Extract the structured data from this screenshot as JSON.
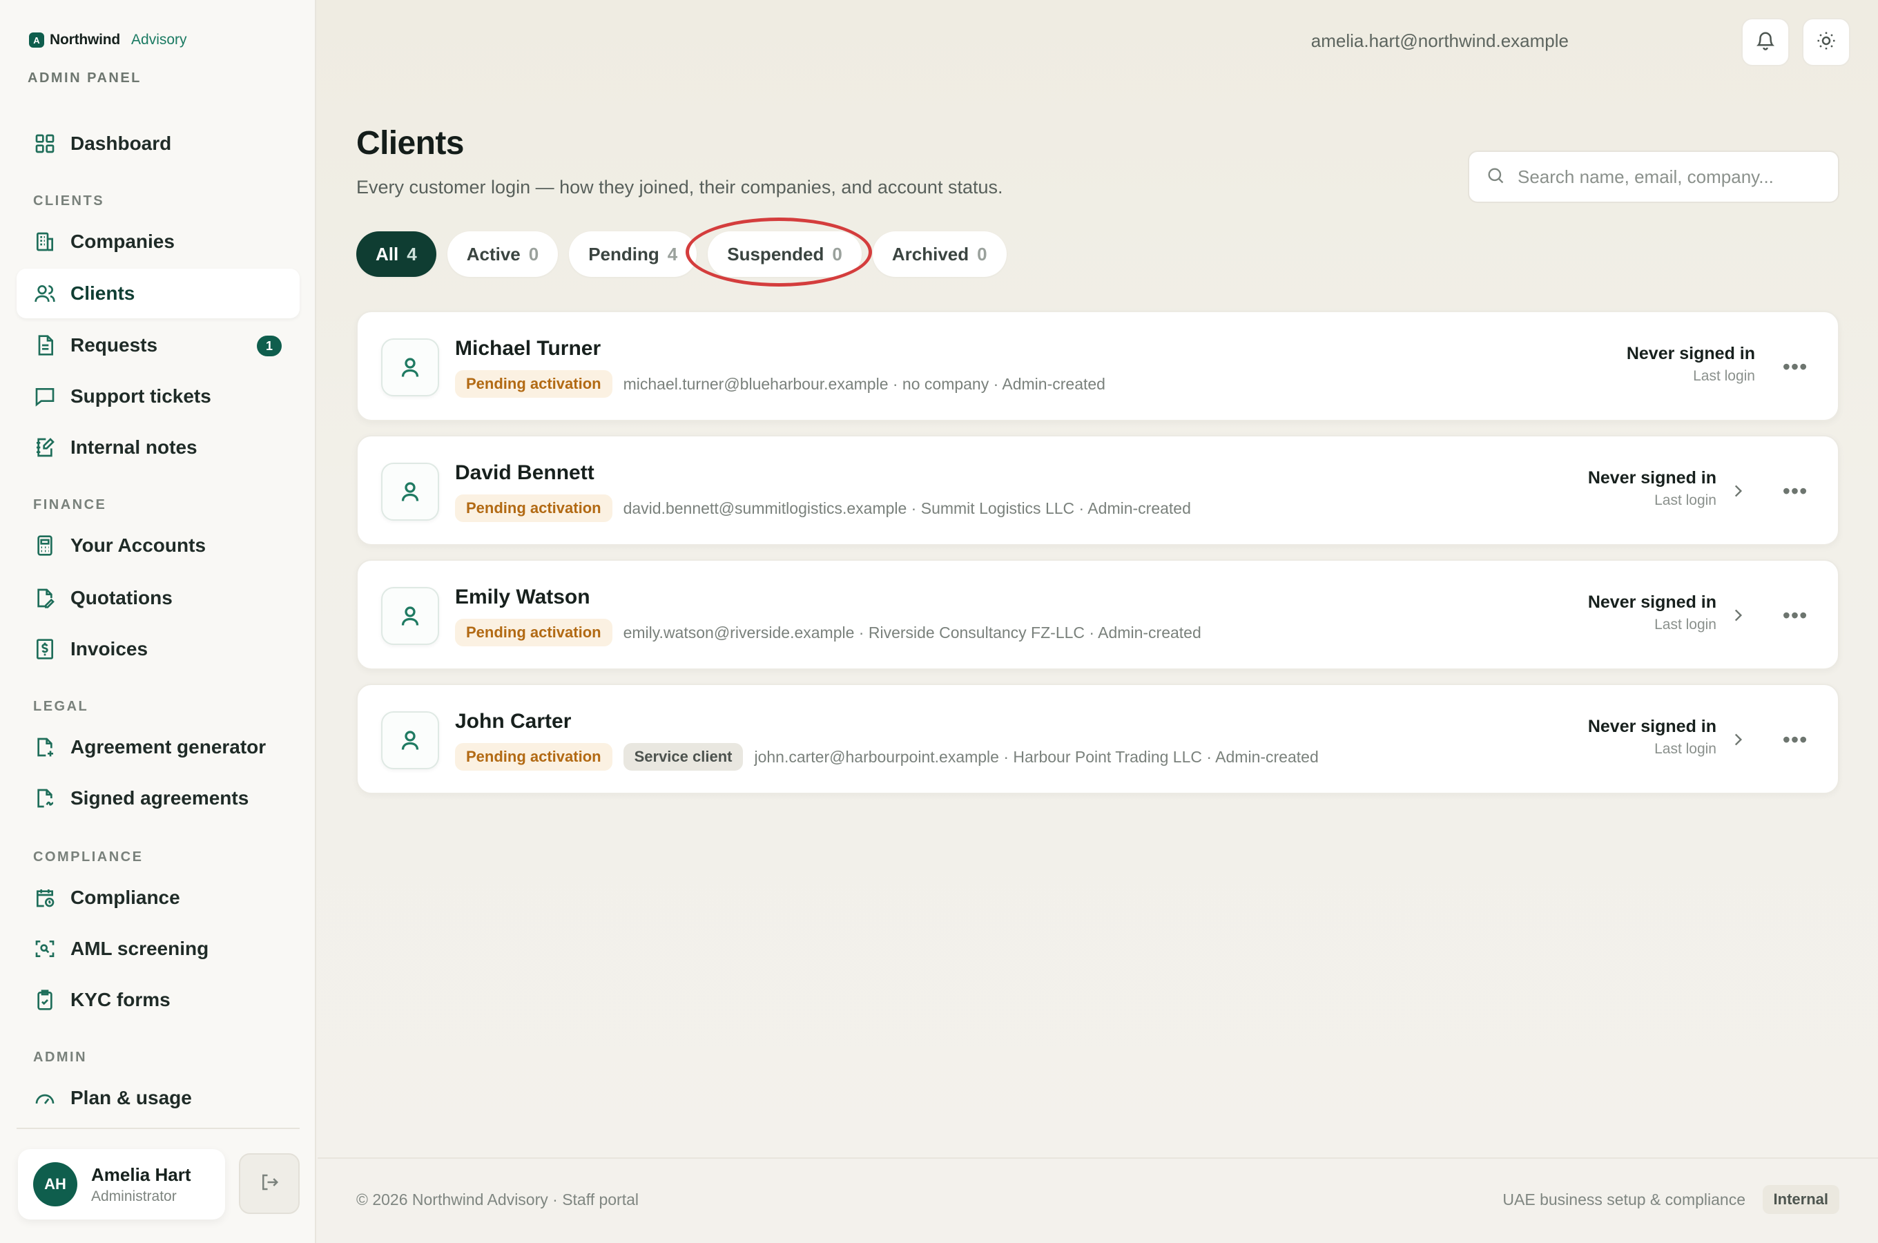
{
  "brand": {
    "logo_letter": "A",
    "name": "Northwind",
    "sub": "Advisory",
    "panel": "ADMIN PANEL"
  },
  "nav": {
    "dashboard": "Dashboard",
    "sections": {
      "clients": "CLIENTS",
      "finance": "FINANCE",
      "legal": "LEGAL",
      "compliance": "COMPLIANCE",
      "admin": "ADMIN"
    },
    "items": {
      "companies": "Companies",
      "clients": "Clients",
      "requests": "Requests",
      "requests_badge": "1",
      "support_tickets": "Support tickets",
      "internal_notes": "Internal notes",
      "your_accounts": "Your Accounts",
      "quotations": "Quotations",
      "invoices": "Invoices",
      "agreement_generator": "Agreement generator",
      "signed_agreements": "Signed agreements",
      "compliance": "Compliance",
      "aml_screening": "AML screening",
      "kyc_forms": "KYC forms",
      "plan_usage": "Plan & usage"
    }
  },
  "user": {
    "initials": "AH",
    "name": "Amelia Hart",
    "role": "Administrator"
  },
  "topbar": {
    "email": "amelia.hart@northwind.example"
  },
  "page": {
    "title": "Clients",
    "subtitle": "Every customer login — how they joined, their companies, and account status.",
    "search_placeholder": "Search name, email, company..."
  },
  "tabs": [
    {
      "label": "All",
      "count": "4"
    },
    {
      "label": "Active",
      "count": "0"
    },
    {
      "label": "Pending",
      "count": "4"
    },
    {
      "label": "Suspended",
      "count": "0"
    },
    {
      "label": "Archived",
      "count": "0"
    }
  ],
  "clients": [
    {
      "name": "Michael Turner",
      "status": "Pending activation",
      "tag": "",
      "details": "michael.turner@blueharbour.example · no company · Admin-created",
      "login_status": "Never signed in",
      "login_label": "Last login"
    },
    {
      "name": "David Bennett",
      "status": "Pending activation",
      "tag": "",
      "details": "david.bennett@summitlogistics.example · Summit Logistics LLC · Admin-created",
      "login_status": "Never signed in",
      "login_label": "Last login"
    },
    {
      "name": "Emily Watson",
      "status": "Pending activation",
      "tag": "",
      "details": "emily.watson@riverside.example · Riverside Consultancy FZ-LLC · Admin-created",
      "login_status": "Never signed in",
      "login_label": "Last login"
    },
    {
      "name": "John Carter",
      "status": "Pending activation",
      "tag": "Service client",
      "details": "john.carter@harbourpoint.example · Harbour Point Trading LLC · Admin-created",
      "login_status": "Never signed in",
      "login_label": "Last login"
    }
  ],
  "footer": {
    "left": "© 2026 Northwind Advisory · Staff portal",
    "right": "UAE business setup & compliance",
    "badge": "Internal"
  },
  "colors": {
    "brand": "#0f5e4d",
    "tab_active": "#0f3d32",
    "pending_text": "#b26a14",
    "highlight": "#d43d3d"
  }
}
